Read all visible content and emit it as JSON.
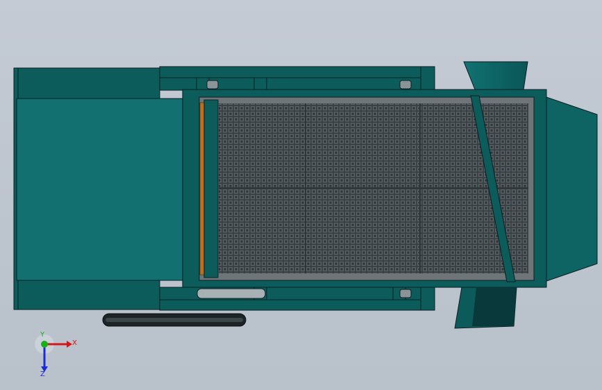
{
  "viewport": {
    "background_color": "#c0c7d0"
  },
  "model": {
    "body_color": "#0d5c5c",
    "body_highlight": "#137070",
    "edge_color": "#0a1e22",
    "mesh_frame_color": "#6e7478",
    "mesh_color": "#2f3436",
    "accent_bar_color": "#c0701c",
    "hopper_color": "#0e6363",
    "chute_color": "#0f6a6a",
    "belt_color": "#1c2426"
  },
  "triad": {
    "x_label": "X",
    "y_label": "Y",
    "z_label": "Z",
    "x_color": "#d01818",
    "y_color": "#18b018",
    "z_color": "#1a2ad8"
  }
}
